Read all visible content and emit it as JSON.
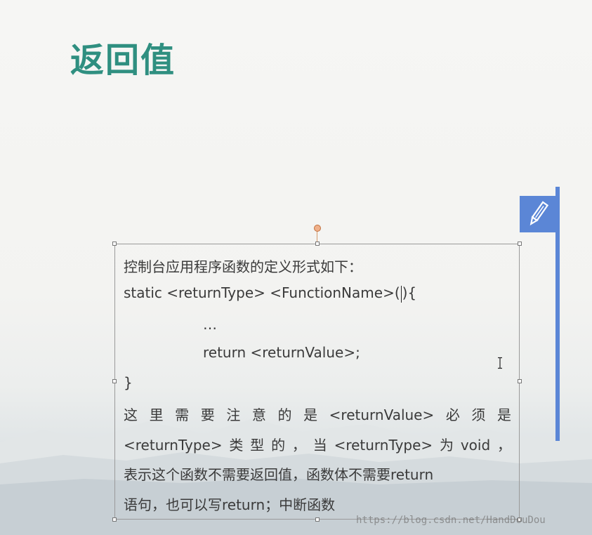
{
  "slide": {
    "title": "返回值"
  },
  "textbox": {
    "line1": "控制台应用程序函数的定义形式如下：",
    "line2_pre": "static <returnType> <FunctionName>(",
    "line2_post": "){",
    "line3": "…",
    "line4": "return <returnValue>;",
    "line5": "}",
    "line6": "这里需要注意的是<returnValue>必须是",
    "line7": "<returnType>类型的，当<returnType>为void，",
    "line8": "表示这个函数不需要返回值，函数体不需要return",
    "line9": "语句，也可以写return；中断函数"
  },
  "watermark": {
    "text": "https://blog.csdn.net/HandDouDou"
  },
  "colors": {
    "title": "#2f8f80",
    "accent": "#5b86d6"
  },
  "icons": {
    "pencil": "pencil-icon",
    "cursor": "text-cursor-icon"
  }
}
